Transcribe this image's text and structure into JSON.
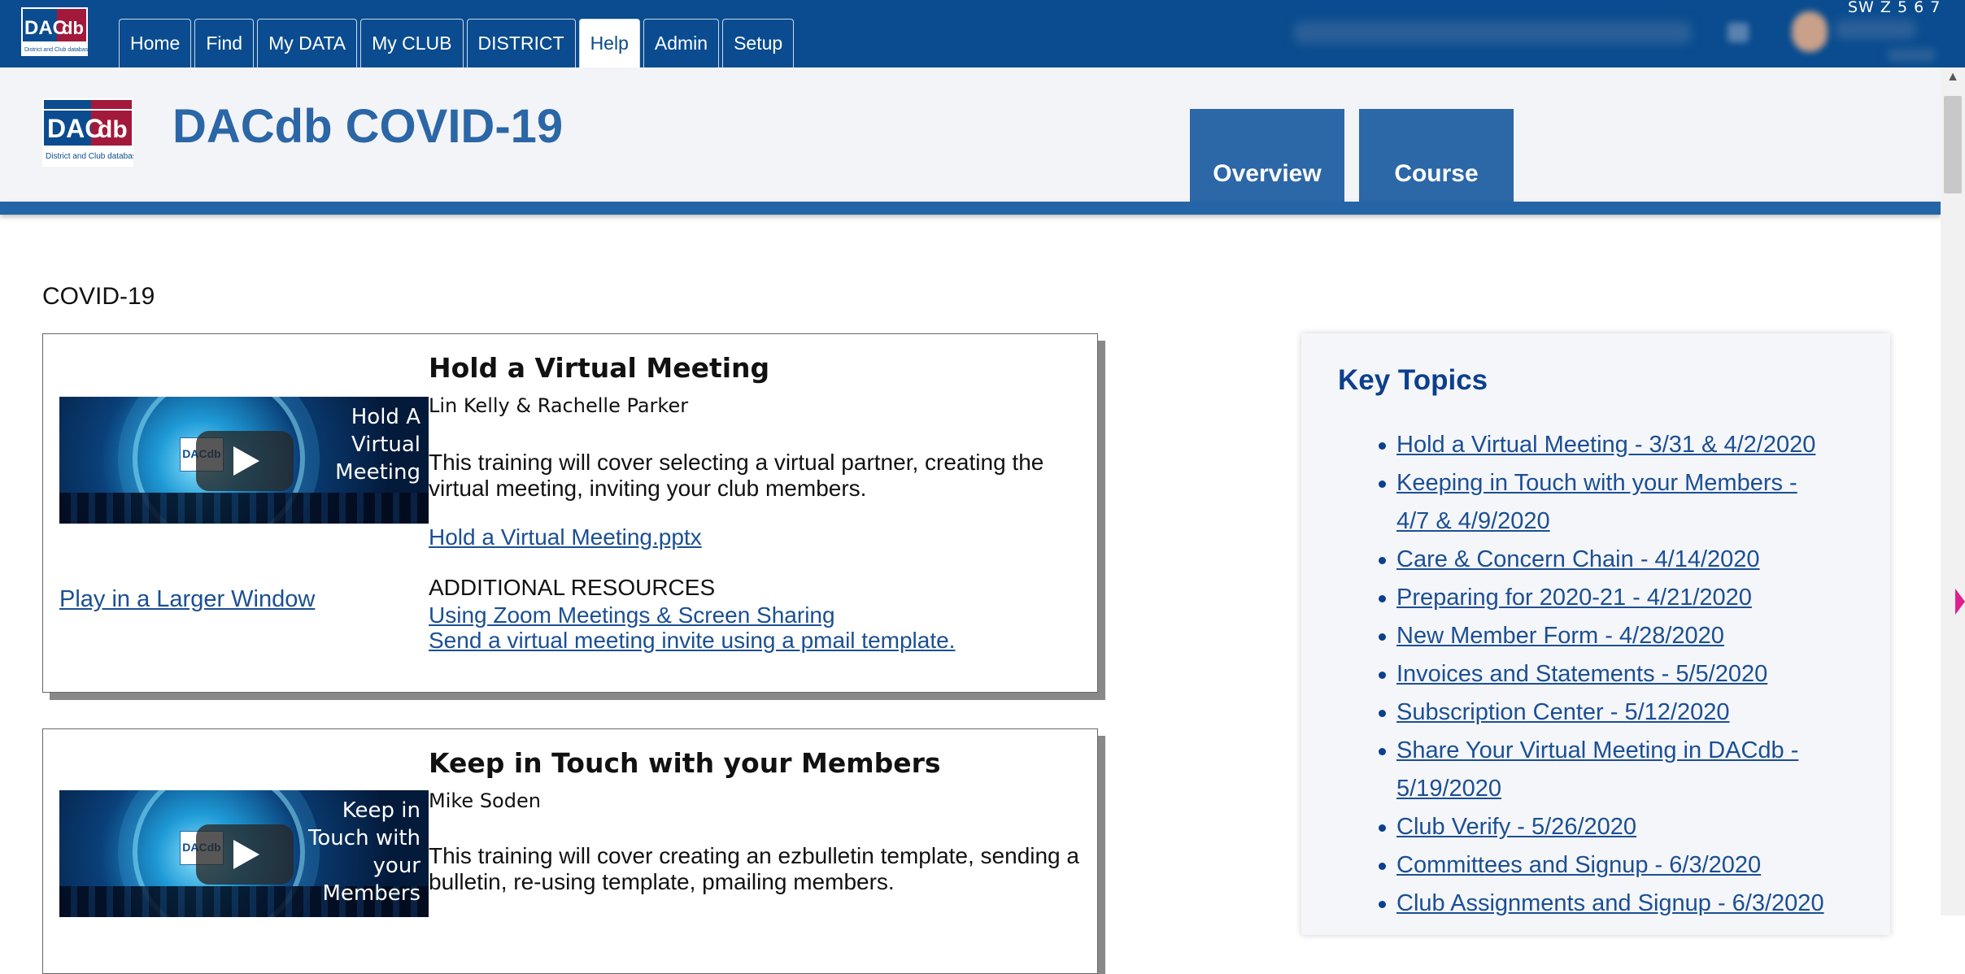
{
  "nav": {
    "logo_text": "DAC db",
    "tabs": [
      {
        "label": "Home"
      },
      {
        "label": "Find"
      },
      {
        "label": "My DATA"
      },
      {
        "label": "My CLUB"
      },
      {
        "label": "DISTRICT"
      },
      {
        "label": "Help",
        "active": true
      },
      {
        "label": "Admin"
      },
      {
        "label": "Setup"
      }
    ],
    "corner_code": "SW Z 5 6 7"
  },
  "header": {
    "title": "DACdb COVID-19",
    "logo_main": "DAC db",
    "logo_sub": "District and Club database",
    "tabs": [
      {
        "label": "Overview"
      },
      {
        "label": "Course"
      }
    ]
  },
  "content": {
    "section_label": "COVID-19",
    "courses": [
      {
        "title": "Hold a Virtual Meeting",
        "thumb_caption_lines": [
          "Hold A",
          "Virtual",
          "Meeting"
        ],
        "author": "Lin Kelly & Rachelle Parker",
        "description": "This training will cover selecting a virtual partner, creating the virtual meeting, inviting your club members.",
        "file_link": "Hold a Virtual Meeting.pptx",
        "additional_label": "ADDITIONAL RESOURCES",
        "additional_links": [
          "Using Zoom Meetings & Screen Sharing",
          "Send a virtual meeting invite using a pmail template."
        ],
        "play_larger": "Play in a Larger Window"
      },
      {
        "title": "Keep in Touch with your Members",
        "thumb_caption_lines": [
          "Keep in",
          "Touch with",
          "your",
          "Members"
        ],
        "author": "Mike Soden",
        "description": "This training will cover creating an ezbulletin template, sending a bulletin, re-using template, pmailing members."
      }
    ]
  },
  "key_topics": {
    "title": "Key Topics",
    "items": [
      "Hold a Virtual Meeting - 3/31 & 4/2/2020",
      "Keeping in Touch with your Members - 4/7 & 4/9/2020",
      "Care & Concern Chain - 4/14/2020",
      "Preparing for 2020-21 - 4/21/2020",
      "New Member Form - 4/28/2020",
      "Invoices and Statements - 5/5/2020",
      "Subscription Center - 5/12/2020",
      "Share Your Virtual Meeting in DACdb - 5/19/2020",
      "Club Verify - 5/26/2020",
      "Committees and Signup - 6/3/2020",
      "Club Assignments and Signup - 6/3/2020"
    ]
  },
  "colors": {
    "nav_bg": "#0a4c8f",
    "accent_blue": "#2c67a8",
    "link": "#1b4f93",
    "key_topics_title": "#0c3f8c"
  }
}
